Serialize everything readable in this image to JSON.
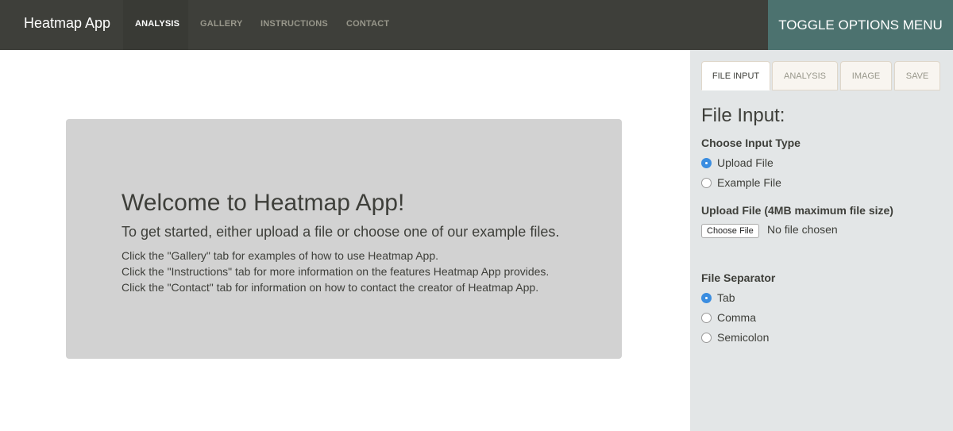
{
  "navbar": {
    "brand": "Heatmap App",
    "items": [
      {
        "label": "ANALYSIS",
        "active": true
      },
      {
        "label": "GALLERY",
        "active": false
      },
      {
        "label": "INSTRUCTIONS",
        "active": false
      },
      {
        "label": "CONTACT",
        "active": false
      }
    ],
    "toggle_label": "TOGGLE OPTIONS MENU"
  },
  "welcome": {
    "title": "Welcome to Heatmap App!",
    "subtitle": "To get started, either upload a file or choose one of our example files.",
    "lines": [
      "Click the \"Gallery\" tab for examples of how to use Heatmap App.",
      "Click the \"Instructions\" tab for more information on the features Heatmap App provides.",
      "Click the \"Contact\" tab for information on how to contact the creator of Heatmap App."
    ]
  },
  "sidebar": {
    "tabs": [
      {
        "label": "FILE INPUT",
        "active": true
      },
      {
        "label": "ANALYSIS",
        "active": false
      },
      {
        "label": "IMAGE",
        "active": false
      },
      {
        "label": "SAVE",
        "active": false
      }
    ],
    "title": "File Input:",
    "input_type": {
      "label": "Choose Input Type",
      "options": [
        {
          "label": "Upload File",
          "checked": true
        },
        {
          "label": "Example File",
          "checked": false
        }
      ]
    },
    "upload": {
      "label": "Upload File (4MB maximum file size)",
      "button_label": "Choose File",
      "status": "No file chosen"
    },
    "separator": {
      "label": "File Separator",
      "options": [
        {
          "label": "Tab",
          "checked": true
        },
        {
          "label": "Comma",
          "checked": false
        },
        {
          "label": "Semicolon",
          "checked": false
        }
      ]
    }
  },
  "colors": {
    "navbar_bg": "#3e3f3a",
    "toggle_bg": "#4c726f",
    "welcome_bg": "#d2d2d2",
    "sidebar_bg": "#e3e6e7",
    "radio_checked": "#3b8de0"
  }
}
